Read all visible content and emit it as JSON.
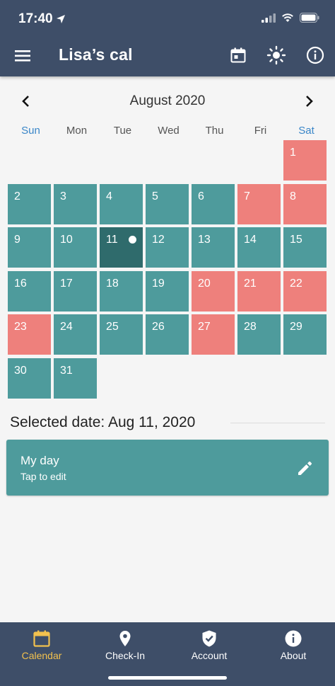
{
  "status": {
    "time": "17:40"
  },
  "header": {
    "title": "Lisa’s cal"
  },
  "calendar": {
    "month_label": "August 2020",
    "weekdays": [
      "Sun",
      "Mon",
      "Tue",
      "Wed",
      "Thu",
      "Fri",
      "Sat"
    ],
    "days": [
      {
        "n": "1",
        "status": "red"
      },
      {
        "n": "2",
        "status": "teal"
      },
      {
        "n": "3",
        "status": "teal"
      },
      {
        "n": "4",
        "status": "teal"
      },
      {
        "n": "5",
        "status": "teal"
      },
      {
        "n": "6",
        "status": "teal"
      },
      {
        "n": "7",
        "status": "red"
      },
      {
        "n": "8",
        "status": "red"
      },
      {
        "n": "9",
        "status": "teal"
      },
      {
        "n": "10",
        "status": "teal"
      },
      {
        "n": "11",
        "status": "selected"
      },
      {
        "n": "12",
        "status": "teal"
      },
      {
        "n": "13",
        "status": "teal"
      },
      {
        "n": "14",
        "status": "teal"
      },
      {
        "n": "15",
        "status": "teal"
      },
      {
        "n": "16",
        "status": "teal"
      },
      {
        "n": "17",
        "status": "teal"
      },
      {
        "n": "18",
        "status": "teal"
      },
      {
        "n": "19",
        "status": "teal"
      },
      {
        "n": "20",
        "status": "red"
      },
      {
        "n": "21",
        "status": "red"
      },
      {
        "n": "22",
        "status": "red"
      },
      {
        "n": "23",
        "status": "red"
      },
      {
        "n": "24",
        "status": "teal"
      },
      {
        "n": "25",
        "status": "teal"
      },
      {
        "n": "26",
        "status": "teal"
      },
      {
        "n": "27",
        "status": "red"
      },
      {
        "n": "28",
        "status": "teal"
      },
      {
        "n": "29",
        "status": "teal"
      },
      {
        "n": "30",
        "status": "teal"
      },
      {
        "n": "31",
        "status": "teal"
      }
    ],
    "colors": {
      "teal": "#4e9b9c",
      "red": "#ee807c",
      "selected": "#2f6b6c",
      "weekend": "#3a86c8",
      "header": "#3e4e68",
      "active_tab": "#f2c14e"
    }
  },
  "selection": {
    "label": "Selected date: Aug 11, 2020"
  },
  "entry": {
    "title": "My day",
    "subtitle": "Tap to edit",
    "icon": "pencil-icon"
  },
  "tabs": [
    {
      "label": "Calendar",
      "icon": "calendar-icon",
      "active": true
    },
    {
      "label": "Check-In",
      "icon": "location-pin-icon",
      "active": false
    },
    {
      "label": "Account",
      "icon": "shield-check-icon",
      "active": false
    },
    {
      "label": "About",
      "icon": "info-icon",
      "active": false
    }
  ]
}
